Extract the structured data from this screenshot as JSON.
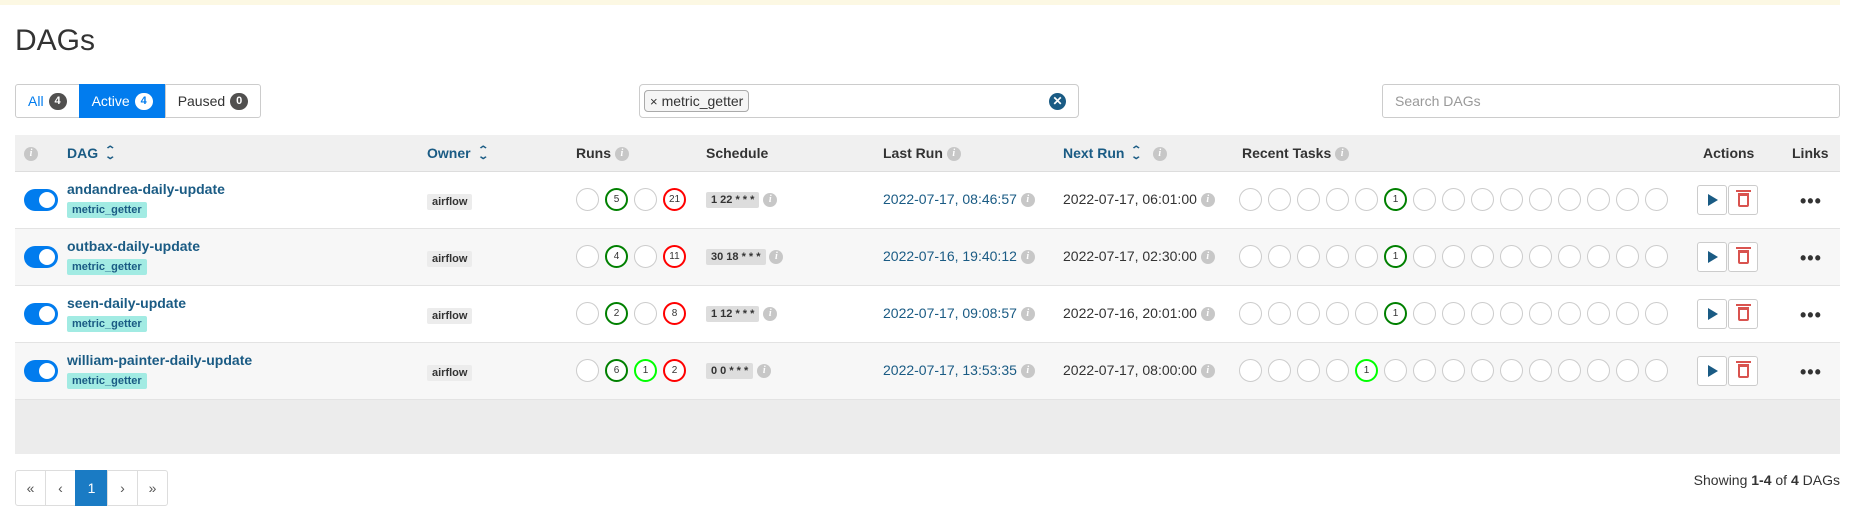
{
  "page": {
    "title": "DAGs"
  },
  "filters": [
    {
      "label": "All",
      "count": "4"
    },
    {
      "label": "Active",
      "count": "4"
    },
    {
      "label": "Paused",
      "count": "0"
    }
  ],
  "tag_filter": {
    "selected_tag": "metric_getter",
    "remove_symbol": "×",
    "clear_symbol": "✕"
  },
  "search": {
    "placeholder": "Search DAGs"
  },
  "columns": {
    "info": "i",
    "dag": "DAG",
    "owner": "Owner",
    "runs": "Runs",
    "schedule": "Schedule",
    "last_run": "Last Run",
    "next_run": "Next Run",
    "recent_tasks": "Recent Tasks",
    "actions": "Actions",
    "links": "Links"
  },
  "colors": {
    "primary": "#017cee",
    "link": "#1a5b84",
    "success": "#008000",
    "running": "#00ff00",
    "failed": "#ff0000",
    "tag_bg": "#a2ebe3"
  },
  "dags": [
    {
      "name": "andandrea-daily-update",
      "tag": "metric_getter",
      "owner": "airflow",
      "runs": {
        "queued": "",
        "success": "5",
        "running": "",
        "failed": "21"
      },
      "schedule": "1 22 * * *",
      "last_run": "2022-07-17, 08:46:57",
      "next_run": "2022-07-17, 06:01:00",
      "recent_task_index": 5,
      "recent_task_count": "1",
      "recent_task_state": "success"
    },
    {
      "name": "outbax-daily-update",
      "tag": "metric_getter",
      "owner": "airflow",
      "runs": {
        "queued": "",
        "success": "4",
        "running": "",
        "failed": "11"
      },
      "schedule": "30 18 * * *",
      "last_run": "2022-07-16, 19:40:12",
      "next_run": "2022-07-17, 02:30:00",
      "recent_task_index": 5,
      "recent_task_count": "1",
      "recent_task_state": "success"
    },
    {
      "name": "seen-daily-update",
      "tag": "metric_getter",
      "owner": "airflow",
      "runs": {
        "queued": "",
        "success": "2",
        "running": "",
        "failed": "8"
      },
      "schedule": "1 12 * * *",
      "last_run": "2022-07-17, 09:08:57",
      "next_run": "2022-07-16, 20:01:00",
      "recent_task_index": 5,
      "recent_task_count": "1",
      "recent_task_state": "success"
    },
    {
      "name": "william-painter-daily-update",
      "tag": "metric_getter",
      "owner": "airflow",
      "runs": {
        "queued": "",
        "success": "6",
        "running": "1",
        "failed": "2"
      },
      "schedule": "0 0 * * *",
      "last_run": "2022-07-17, 13:53:35",
      "next_run": "2022-07-17, 08:00:00",
      "recent_task_index": 4,
      "recent_task_count": "1",
      "recent_task_state": "running"
    }
  ],
  "pagination": {
    "first": "«",
    "prev": "‹",
    "current": "1",
    "next": "›",
    "last": "»"
  },
  "footer": {
    "showing_prefix": "Showing",
    "range": "1-4",
    "of": "of",
    "total": "4",
    "suffix": "DAGs"
  },
  "icons": {
    "trigger": "play-icon",
    "delete": "trash-icon",
    "links": "ellipsis-icon",
    "info": "info-icon",
    "sort": "sort-icon"
  },
  "links_glyph": "•••"
}
